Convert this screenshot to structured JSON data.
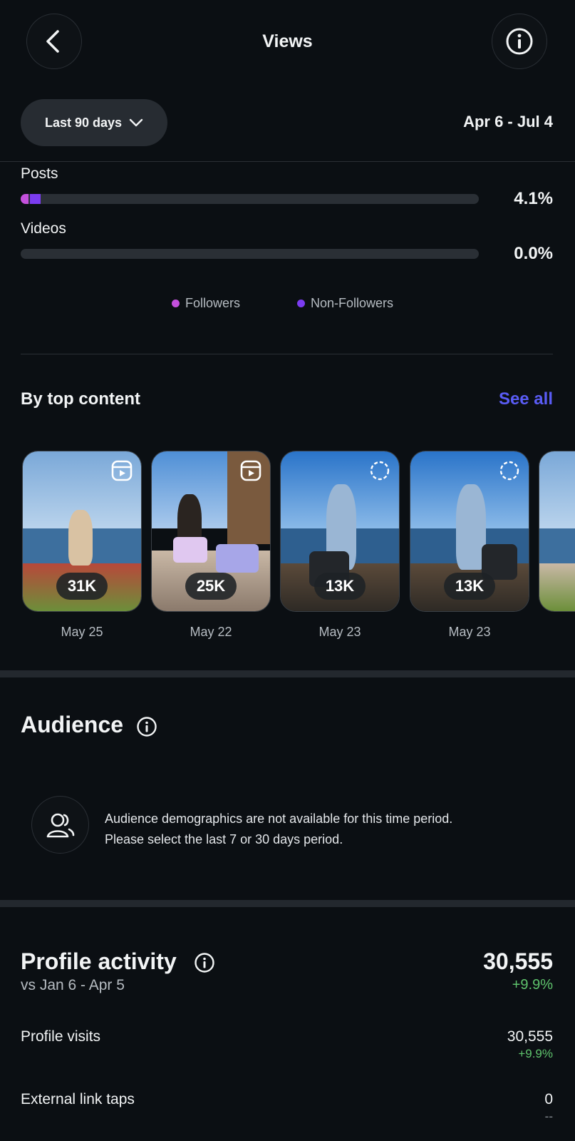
{
  "header": {
    "title": "Views"
  },
  "filter": {
    "selected": "Last 90 days",
    "date_range": "Apr 6 - Jul 4"
  },
  "content_types": [
    {
      "label": "Posts",
      "value": "4.1%",
      "followers_fraction": 0.017,
      "non_followers_fraction": 0.024
    },
    {
      "label": "Videos",
      "value": "0.0%",
      "followers_fraction": 0,
      "non_followers_fraction": 0
    }
  ],
  "legend": [
    {
      "label": "Followers",
      "color": "#c450dc"
    },
    {
      "label": "Non-Followers",
      "color": "#7b3cf0"
    }
  ],
  "top_content": {
    "heading": "By top content",
    "see_all": "See all",
    "items": [
      {
        "views": "31K",
        "date": "May 25",
        "type_icon": "reels-icon"
      },
      {
        "views": "25K",
        "date": "May 22",
        "type_icon": "reels-icon"
      },
      {
        "views": "13K",
        "date": "May 23",
        "type_icon": "story-icon"
      },
      {
        "views": "13K",
        "date": "May 23",
        "type_icon": "story-icon"
      }
    ]
  },
  "audience": {
    "heading": "Audience",
    "message_line1": "Audience demographics are not available for this time period.",
    "message_line2": "Please select the last 7 or 30 days period."
  },
  "profile_activity": {
    "heading": "Profile activity",
    "comparison": "vs Jan 6 - Apr 5",
    "total": "30,555",
    "total_change": "+9.9%",
    "rows": [
      {
        "label": "Profile visits",
        "value": "30,555",
        "change": "+9.9%"
      },
      {
        "label": "External link taps",
        "value": "0",
        "change": "--"
      }
    ]
  },
  "colors": {
    "accent": "#5a5cf5",
    "positive": "#5fc46d",
    "background": "#0b0f13"
  }
}
